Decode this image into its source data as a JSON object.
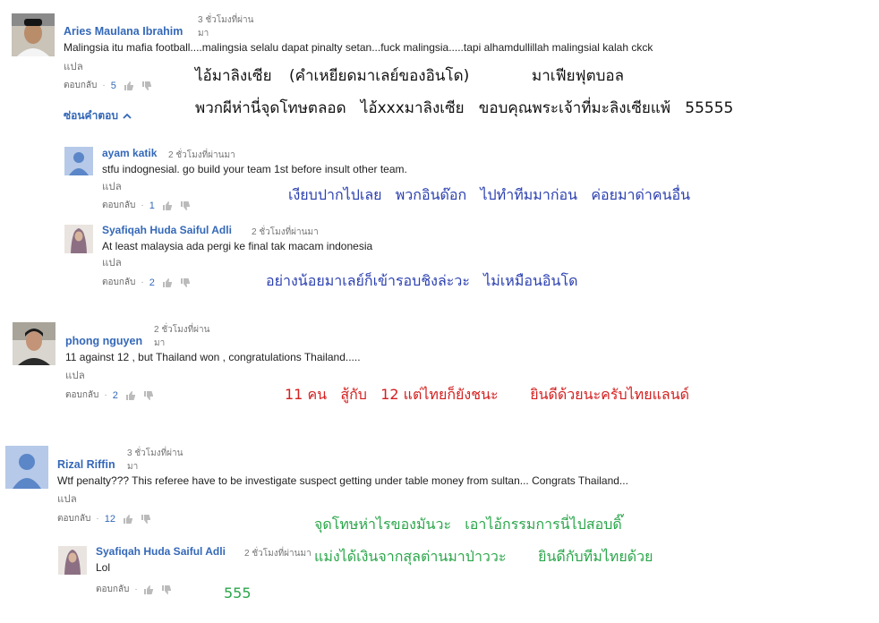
{
  "labels": {
    "reply": "ตอบกลับ",
    "translate": "แปล",
    "ma": "มา",
    "hide_replies": "ซ่อนคำตอบ"
  },
  "comments": {
    "c1": {
      "author": "Aries Maulana Ibrahim",
      "time": "3 ชั่วโมงที่ผ่าน",
      "text": "Malingsia itu mafia football....malingsia selalu dapat pinalty setan...fuck malingsia.....tapi alhamdullillah malingsial kalah ckck",
      "likes": "5"
    },
    "r1": {
      "author": "ayam katik",
      "time": "2 ชั่วโมงที่ผ่านมา",
      "text": "stfu indognesial. go build your team 1st before insult other team.",
      "likes": "1"
    },
    "r2": {
      "author": "Syafiqah Huda Saiful Adli",
      "time": "2 ชั่วโมงที่ผ่านมา",
      "text": "At least malaysia ada pergi ke final tak macam indonesia",
      "likes": "2"
    },
    "c2": {
      "author": "phong nguyen",
      "time": "2 ชั่วโมงที่ผ่าน",
      "text": "11 against 12 , but Thailand won , congratulations Thailand.....",
      "likes": "2"
    },
    "c3": {
      "author": "Rizal Riffin",
      "time": "3 ชั่วโมงที่ผ่าน",
      "text": "Wtf penalty??? This referee have to be investigate suspect getting under table money from sultan... Congrats Thailand...",
      "likes": "12"
    },
    "r3": {
      "author": "Syafiqah Huda Saiful Adli",
      "time": "2 ชั่วโมงที่ผ่านมา",
      "text": "Lol"
    }
  },
  "overlays": {
    "t1a": "ไอ้มาลิงเซีย",
    "t1b": "(คำเหยียดมาเลย์ของอินโด)",
    "t1c": "มาเฟียฟุตบอล",
    "t2": "พวกผีห่านี่จุดโทษตลอด   ไอ้xxxมาลิงเซีย   ขอบคุณพระเจ้าที่มะลิงเซียแพ้   55555",
    "t3": "เงียบปากไปเลย   พวกอินด๊อก   ไปทำทีมมาก่อน   ค่อยมาด่าคนอื่น",
    "t4": "อย่างน้อยมาเลย์ก็เข้ารอบชิงล่ะวะ   ไม่เหมือนอินโด",
    "t5": "11 คน   สู้กับ   12 แต่ไทยก็ยังชนะ       ยินดีด้วยนะครับไทยแลนด์",
    "t6": "จุดโทษห่าไรของมันวะ   เอาไอ้กรรมการนี่ไปสอบดิ๊",
    "t7": "แม่งได้เงินจากสุลต่านมาป่าววะ       ยินดีกับทีมไทยด้วย",
    "t8": "555"
  },
  "colors": {
    "link": "#3468b8",
    "overlay_black": "#111111",
    "overlay_blue": "#2a3fb0",
    "overlay_red": "#d42020",
    "overlay_green": "#2aa64a"
  }
}
